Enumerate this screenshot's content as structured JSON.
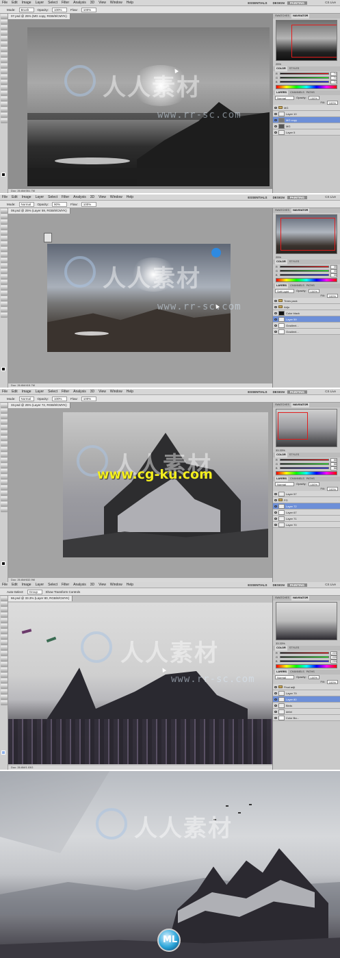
{
  "menus": [
    "File",
    "Edit",
    "Image",
    "Layer",
    "Select",
    "Filter",
    "Analysis",
    "3D",
    "View",
    "Window",
    "Help"
  ],
  "workspace": {
    "essentials": "ESSENTIALS",
    "design": "DESIGN",
    "painting": "PAINTING",
    "cslive": "CS Live"
  },
  "panel_tabs": {
    "swatches": "SWATCHES",
    "navigator": "NAVIGATOR",
    "color": "COLOR",
    "styles": "STYLES",
    "layers": "LAYERS",
    "channels": "CHANNELS",
    "paths": "PATHS"
  },
  "panel_labels": {
    "opacity": "Opacity:",
    "fill": "Fill:"
  },
  "shots": [
    {
      "options": {
        "mode_label": "Mode:",
        "mode": "Brush",
        "opacity_label": "Opacity:",
        "opacity": "100%",
        "flow_label": "Flow:",
        "flow": "100%"
      },
      "doc_tab": "07.psd @ 25% (MG copy, RGB/8/CMYK)",
      "status": "Doc: 26.6M/351.7M",
      "zoom": "25%",
      "blend": "Normal",
      "layer_opacity": "100%",
      "layer_fill": "100%",
      "color": {
        "r": "74",
        "g": "74",
        "b": "74"
      },
      "layers": [
        {
          "name": "MG",
          "type": "folder",
          "selected": false
        },
        {
          "name": "Layer 10",
          "type": "layer",
          "selected": false
        },
        {
          "name": "MG copy",
          "type": "layer",
          "selected": true
        },
        {
          "name": "MG",
          "type": "layer",
          "selected": false
        },
        {
          "name": "Layer 5",
          "type": "layer",
          "selected": false
        }
      ]
    },
    {
      "options": {
        "mode_label": "Mode:",
        "mode": "Normal",
        "opacity_label": "Opacity:",
        "opacity": "90%",
        "flow_label": "Flow:",
        "flow": "100%"
      },
      "doc_tab": "08.psd @ 25% (Layer 59, RGB/8/CMYK)",
      "status": "Doc: 26.6M/415.7M",
      "zoom": "25%",
      "blend": "Soft Light",
      "layer_opacity": "100%",
      "layer_fill": "100%",
      "color": {
        "r": "35",
        "g": "35",
        "b": "35"
      },
      "layers": [
        {
          "name": "Trees pack",
          "type": "folder",
          "selected": false
        },
        {
          "name": "Adju",
          "type": "folder",
          "selected": false
        },
        {
          "name": "Color black",
          "type": "layer",
          "selected": false
        },
        {
          "name": "Layer 59",
          "type": "layer",
          "selected": true
        },
        {
          "name": "Gradient...",
          "type": "mask",
          "selected": false
        },
        {
          "name": "Gradient...",
          "type": "mask",
          "selected": false
        }
      ]
    },
    {
      "options": {
        "mode_label": "Mode:",
        "mode": "Normal",
        "opacity_label": "Opacity:",
        "opacity": "100%",
        "flow_label": "Flow:",
        "flow": "100%"
      },
      "doc_tab": "33.psd @ 25% (Layer 72, RGB/8/CMYK)",
      "status": "Doc: 26.6M/632.9M",
      "zoom": "33.33%",
      "blend": "Normal",
      "layer_opacity": "100%",
      "layer_fill": "100%",
      "color": {
        "r": "88",
        "g": "88",
        "b": "88"
      },
      "layers": [
        {
          "name": "Layer 57",
          "type": "layer",
          "selected": false
        },
        {
          "name": "FG",
          "type": "folder",
          "selected": false
        },
        {
          "name": "Layer 72",
          "type": "layer",
          "selected": true
        },
        {
          "name": "Layer 67",
          "type": "mask",
          "selected": false
        },
        {
          "name": "Layer 71",
          "type": "layer",
          "selected": false
        },
        {
          "name": "Layer 70",
          "type": "layer",
          "selected": false
        }
      ]
    },
    {
      "options": {
        "mode_label": "Auto-Select:",
        "mode": "Group",
        "opacity_label": "",
        "opacity": "Show Transform Controls",
        "flow_label": "",
        "flow": ""
      },
      "doc_tab": "66.psd @ 33.3% (Layer 80, RGB/8/CMYK)",
      "status": "Doc: 26.6M/1.03G",
      "zoom": "33.33%",
      "blend": "Normal",
      "layer_opacity": "100%",
      "layer_fill": "100%",
      "color": {
        "r": "223",
        "g": "229",
        "b": "233"
      },
      "layers": [
        {
          "name": "Final adjt",
          "type": "folder",
          "selected": false
        },
        {
          "name": "Layer 79",
          "type": "layer",
          "selected": false
        },
        {
          "name": "Layer 80",
          "type": "layer",
          "selected": true
        },
        {
          "name": "Birds",
          "type": "layer",
          "selected": false
        },
        {
          "name": "debri",
          "type": "layer",
          "selected": false
        },
        {
          "name": "Color Ba...",
          "type": "mask",
          "selected": false
        }
      ]
    }
  ],
  "watermark": {
    "chinese": "人人素材",
    "url_yellow": "www.cg-ku.com",
    "url_faint": "www.rr-sc.com",
    "logo_letters": "ML"
  },
  "colors": {
    "selection_blue": "#6d8fd8",
    "nav_red": "#e21b1b",
    "url_yellow": "#f3ee1d"
  }
}
